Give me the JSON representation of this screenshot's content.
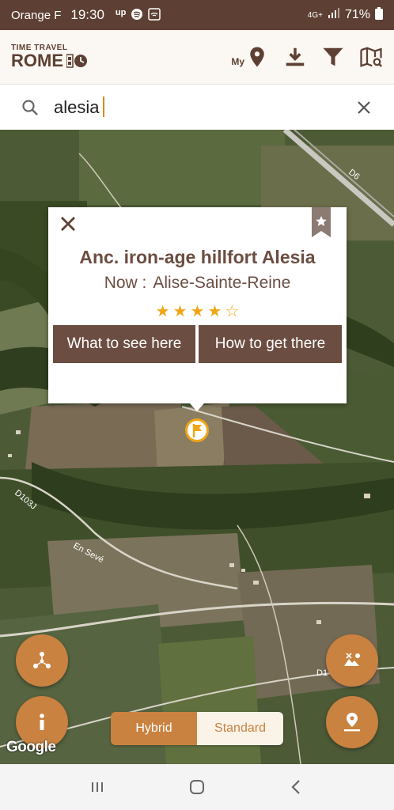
{
  "status_bar": {
    "carrier": "Orange F",
    "time": "19:30",
    "app_icons": [
      "up",
      "spotify",
      "wifi"
    ],
    "network": "4G+",
    "battery": "71%"
  },
  "header": {
    "logo_top": "TIME TRAVEL",
    "logo_main": "ROME",
    "my_label": "My"
  },
  "search": {
    "value": "alesia"
  },
  "popup": {
    "title": "Anc. iron-age hillfort Alesia",
    "now_prefix": "Now :",
    "now_place": "Alise-Sainte-Reine",
    "rating": 4,
    "rating_max": 5,
    "btn_see": "What to see here",
    "btn_get": "How to get there"
  },
  "map": {
    "road_labels": [
      "D6",
      "D103J",
      "En Sevé",
      "D1"
    ],
    "type_options": [
      "Hybrid",
      "Standard"
    ],
    "selected_type": "Hybrid",
    "attribution": "Google"
  },
  "colors": {
    "brand_brown": "#6b4e41",
    "accent_orange": "#c98240",
    "star": "#f0a516"
  }
}
